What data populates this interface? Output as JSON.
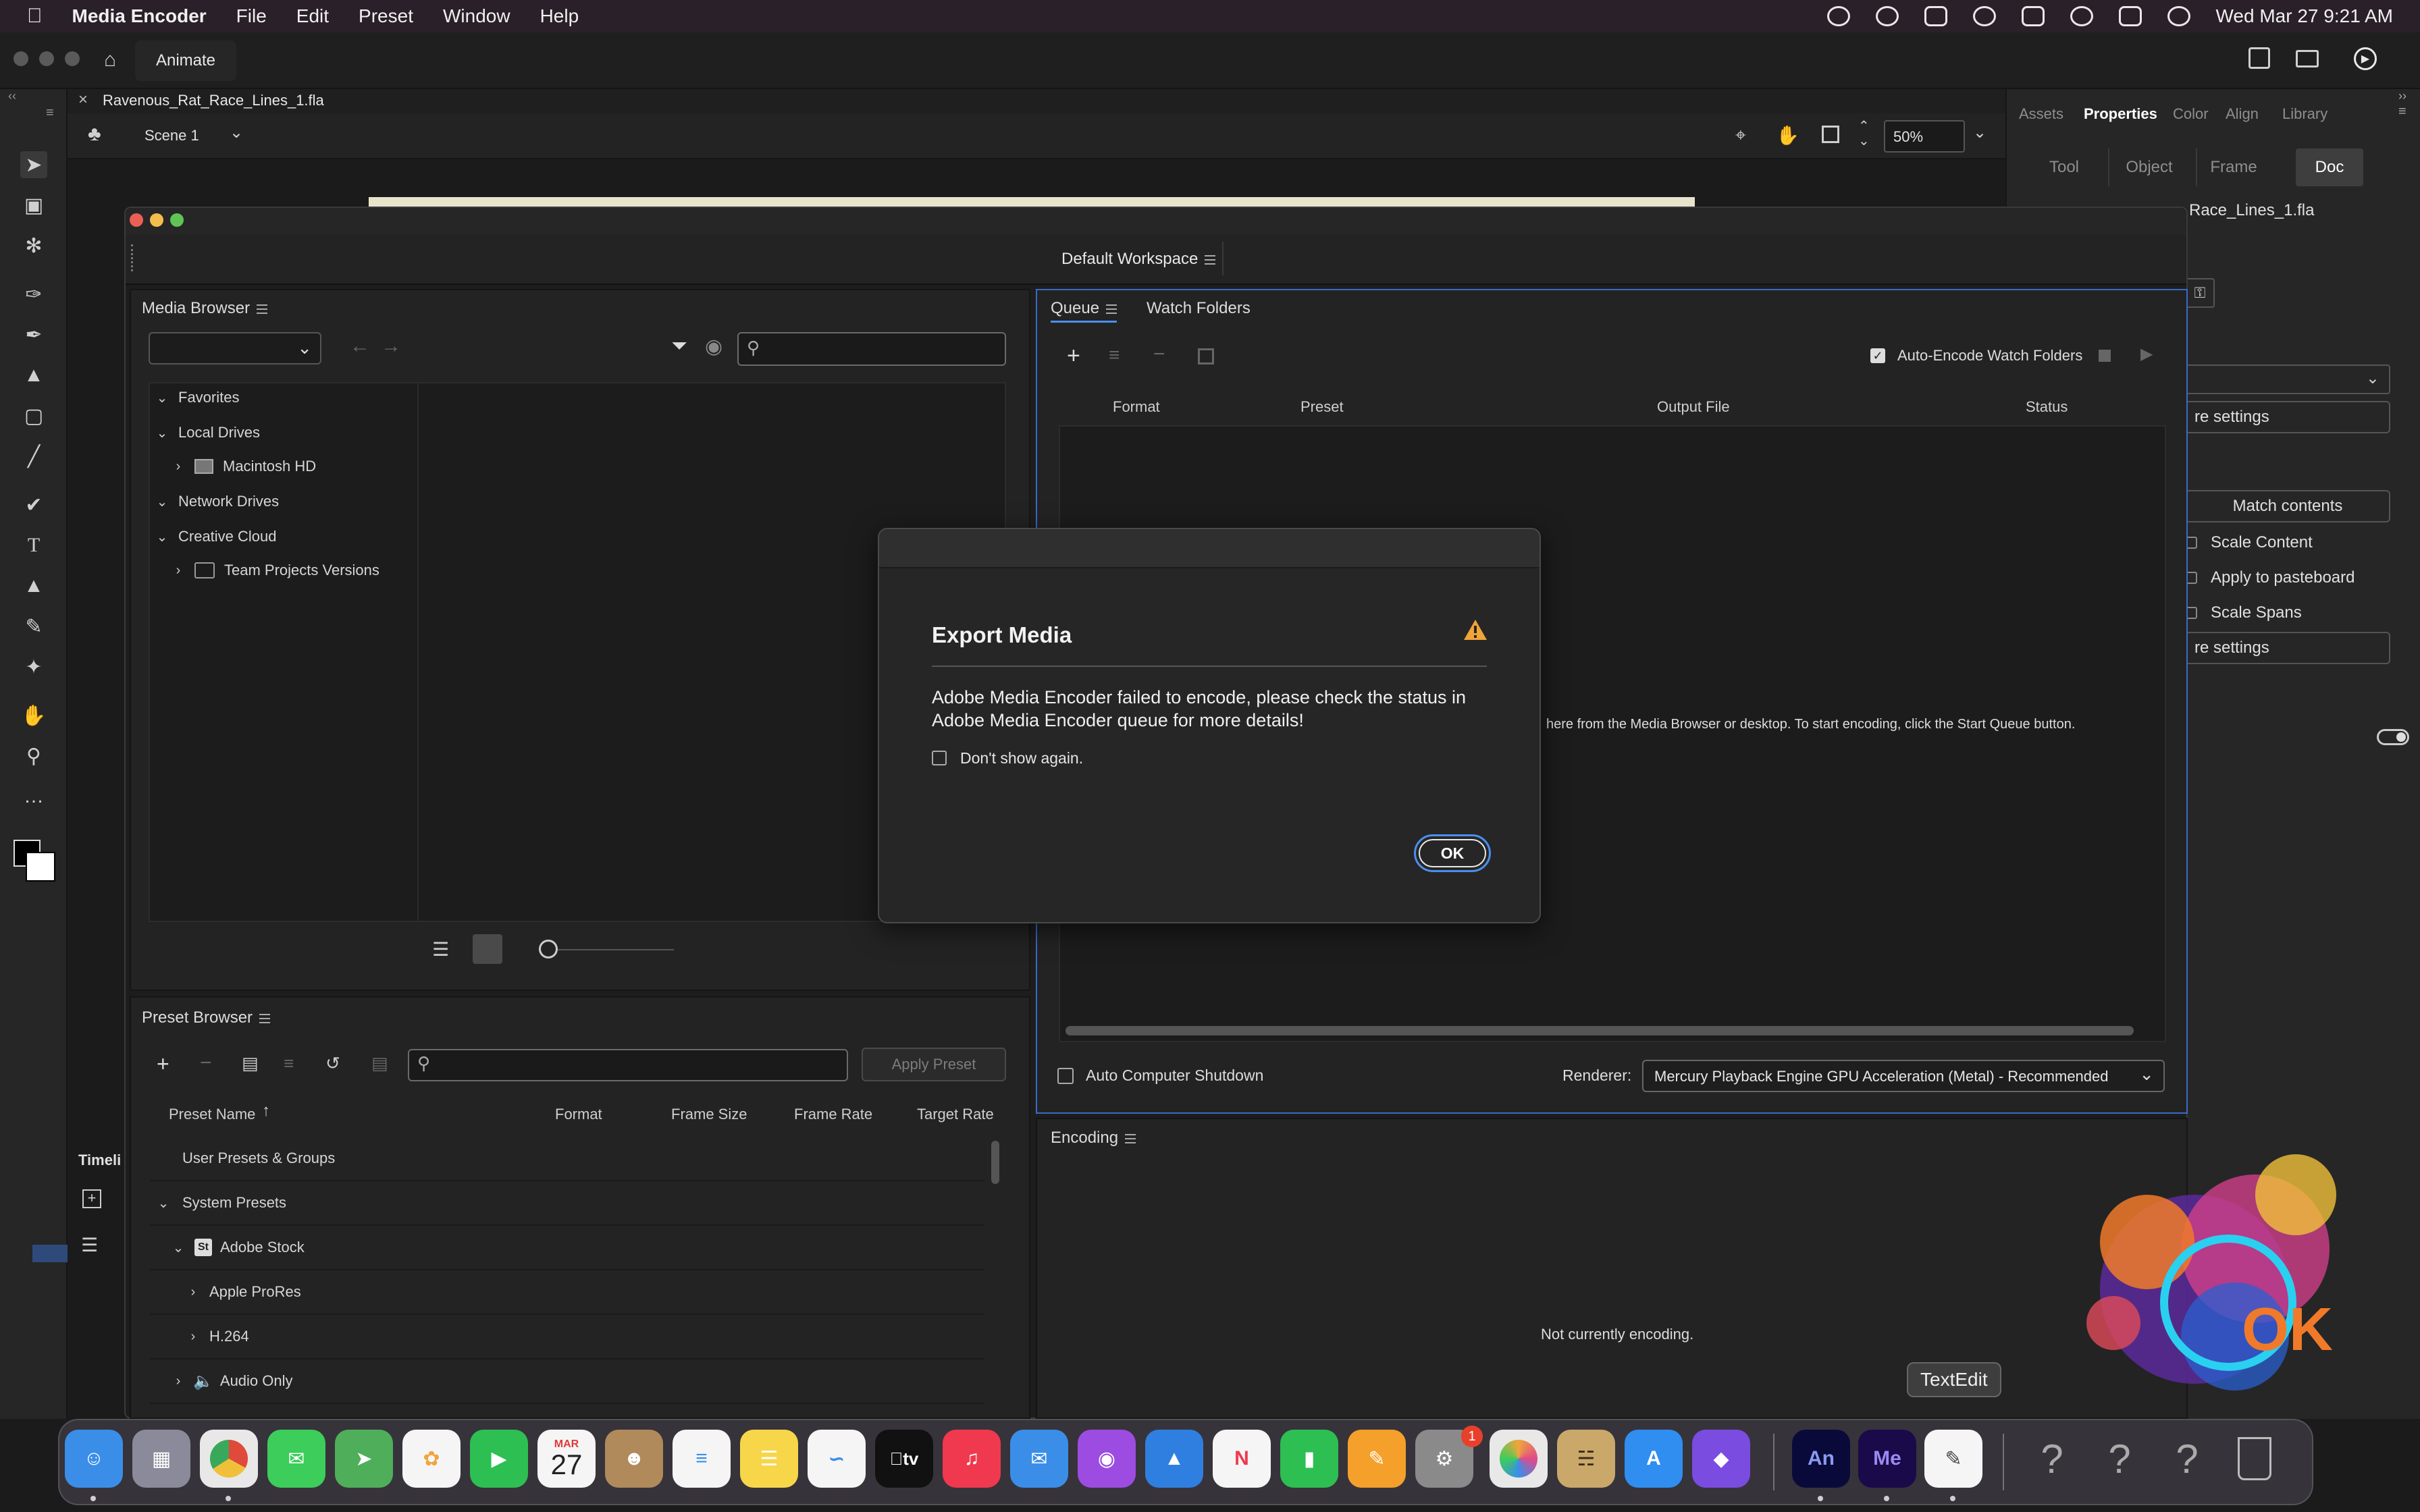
{
  "menubar": {
    "app_name": "Media Encoder",
    "menus": [
      "File",
      "Edit",
      "Preset",
      "Window",
      "Help"
    ],
    "clock": "Wed Mar 27  9:21 AM"
  },
  "animate": {
    "tab_label": "Animate",
    "document_tab": "Ravenous_Rat_Race_Lines_1.fla",
    "scene_label": "Scene 1",
    "zoom_value": "50%",
    "timeline_label": "Timeli",
    "panel_tabs": [
      "Assets",
      "Properties",
      "Color",
      "Align",
      "Library"
    ],
    "active_panel_tab": "Properties",
    "sub_tabs": [
      "Tool",
      "Object",
      "Frame",
      "Doc"
    ],
    "active_sub_tab": "Doc",
    "doc_filename_fragment": "Race_Lines_1.fla",
    "more_settings_1": "re settings",
    "match_contents": "Match contents",
    "checks": [
      "Scale Content",
      "Apply to pasteboard",
      "Scale Spans"
    ],
    "more_settings_2": "re settings"
  },
  "media_encoder": {
    "workspace_label": "Default Workspace",
    "media_browser": {
      "title": "Media Browser",
      "tree": [
        {
          "label": "Favorites",
          "expanded": true,
          "indent": 0
        },
        {
          "label": "Local Drives",
          "expanded": true,
          "indent": 0
        },
        {
          "label": "Macintosh HD",
          "expanded": false,
          "indent": 1
        },
        {
          "label": "Network Drives",
          "expanded": true,
          "indent": 0
        },
        {
          "label": "Creative Cloud",
          "expanded": true,
          "indent": 0
        },
        {
          "label": "Team Projects Versions",
          "expanded": false,
          "indent": 1
        }
      ]
    },
    "queue": {
      "tabs": [
        "Queue",
        "Watch Folders"
      ],
      "active_tab": "Queue",
      "auto_encode_label": "Auto-Encode Watch Folders",
      "auto_encode_checked": true,
      "columns": [
        "Format",
        "Preset",
        "Output File",
        "Status"
      ],
      "empty_hint": "here from the Media Browser or desktop.  To start encoding, click the Start Queue button.",
      "auto_shutdown_label": "Auto Computer Shutdown",
      "renderer_label": "Renderer:",
      "renderer_value": "Mercury Playback Engine GPU Acceleration (Metal) - Recommended"
    },
    "preset_browser": {
      "title": "Preset Browser",
      "apply_button": "Apply Preset",
      "columns": [
        "Preset Name",
        "Format",
        "Frame Size",
        "Frame Rate",
        "Target Rate"
      ],
      "rows": [
        {
          "label": "User Presets & Groups",
          "chev": "",
          "indent": 0
        },
        {
          "label": "System Presets",
          "chev": "⌄",
          "indent": 0
        },
        {
          "label": "Adobe Stock",
          "chev": "⌄",
          "indent": 1
        },
        {
          "label": "Apple ProRes",
          "chev": "›",
          "indent": 2
        },
        {
          "label": "H.264",
          "chev": "›",
          "indent": 2
        },
        {
          "label": "Audio Only",
          "chev": "›",
          "indent": 1
        }
      ]
    },
    "encoding": {
      "title": "Encoding",
      "status": "Not currently encoding."
    }
  },
  "dialog": {
    "title": "Export Media",
    "message": "Adobe Media Encoder failed to encode, please check the status in Adobe Media Encoder queue for more details!",
    "checkbox_label": "Don't show again.",
    "checkbox_checked": false,
    "ok_label": "OK"
  },
  "dock": {
    "tooltip": "TextEdit",
    "calendar_month": "MAR",
    "calendar_day": "27",
    "settings_badge": "1",
    "tv_label": "tv",
    "an_label": "An",
    "me_label": "Me",
    "apps": [
      {
        "name": "finder-icon",
        "color": "#3a8ee8"
      },
      {
        "name": "launchpad-icon",
        "color": "#8a8a9a"
      },
      {
        "name": "chrome-icon",
        "color": "#e0e0e0"
      },
      {
        "name": "messages-icon",
        "color": "#3ccd5a"
      },
      {
        "name": "maps-icon",
        "color": "#4fae5a"
      },
      {
        "name": "photos-icon",
        "color": "#f0a53c"
      },
      {
        "name": "facetime-icon",
        "color": "#2dbf52"
      },
      {
        "name": "calendar-icon",
        "color": "#f5f5f5"
      },
      {
        "name": "contacts-icon",
        "color": "#b08a5a"
      },
      {
        "name": "reminders-icon",
        "color": "#f5f5f5"
      },
      {
        "name": "notes-icon",
        "color": "#f7d64a"
      },
      {
        "name": "freeform-icon",
        "color": "#f5f5f5"
      },
      {
        "name": "appletv-icon",
        "color": "#111111"
      },
      {
        "name": "music-icon",
        "color": "#f0394e"
      },
      {
        "name": "mail-icon",
        "color": "#3a8ee8"
      },
      {
        "name": "podcasts-icon",
        "color": "#9c4ce0"
      },
      {
        "name": "keynote-icon",
        "color": "#2f7fe0"
      },
      {
        "name": "news-icon",
        "color": "#f03a4e"
      },
      {
        "name": "numbers-icon",
        "color": "#2dbf52"
      },
      {
        "name": "pages-icon",
        "color": "#f5a02a"
      },
      {
        "name": "system-settings-icon",
        "color": "#8a8a8a"
      },
      {
        "name": "sketch-icon",
        "color": "#e8e8e8"
      },
      {
        "name": "cat-app-icon",
        "color": "#c9a86a"
      },
      {
        "name": "appstore-icon",
        "color": "#2f8ef0"
      },
      {
        "name": "obsidian-icon",
        "color": "#7a4ce0"
      },
      {
        "name": "animate-icon",
        "color": "#0a0a3a"
      },
      {
        "name": "media-encoder-icon",
        "color": "#1a0a4a"
      },
      {
        "name": "textedit-icon",
        "color": "#f5f5f5"
      },
      {
        "name": "help-icon-1",
        "color": "#555555"
      },
      {
        "name": "help-icon-2",
        "color": "#555555"
      },
      {
        "name": "help-icon-3",
        "color": "#555555"
      },
      {
        "name": "trash-icon",
        "color": "#888888"
      }
    ]
  },
  "colors": {
    "accent_blue": "#4a8ff0",
    "warning_orange": "#f0a43a",
    "panel_bg": "#232323"
  }
}
